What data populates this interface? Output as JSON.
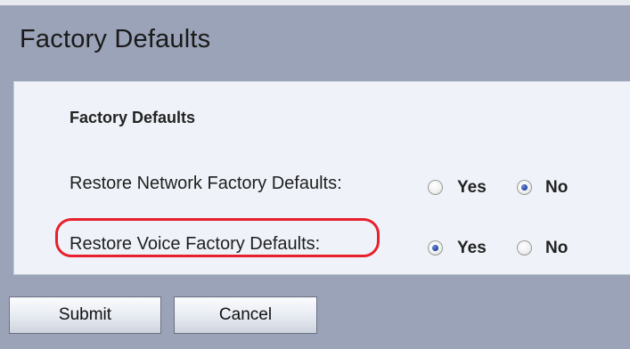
{
  "page": {
    "title": "Factory Defaults"
  },
  "panel": {
    "section_title": "Factory Defaults",
    "rows": [
      {
        "label": "Restore Network Factory Defaults:",
        "options": [
          {
            "label": "Yes",
            "selected": false
          },
          {
            "label": "No",
            "selected": true
          }
        ],
        "highlighted": false
      },
      {
        "label": "Restore Voice Factory Defaults:",
        "options": [
          {
            "label": "Yes",
            "selected": true
          },
          {
            "label": "No",
            "selected": false
          }
        ],
        "highlighted": true
      }
    ]
  },
  "buttons": {
    "submit": "Submit",
    "cancel": "Cancel"
  },
  "colors": {
    "page_background": "#9ba3b8",
    "panel_background": "#eff3f9",
    "highlight": "#e8202c",
    "radio_selected": "#1e3f9a"
  }
}
